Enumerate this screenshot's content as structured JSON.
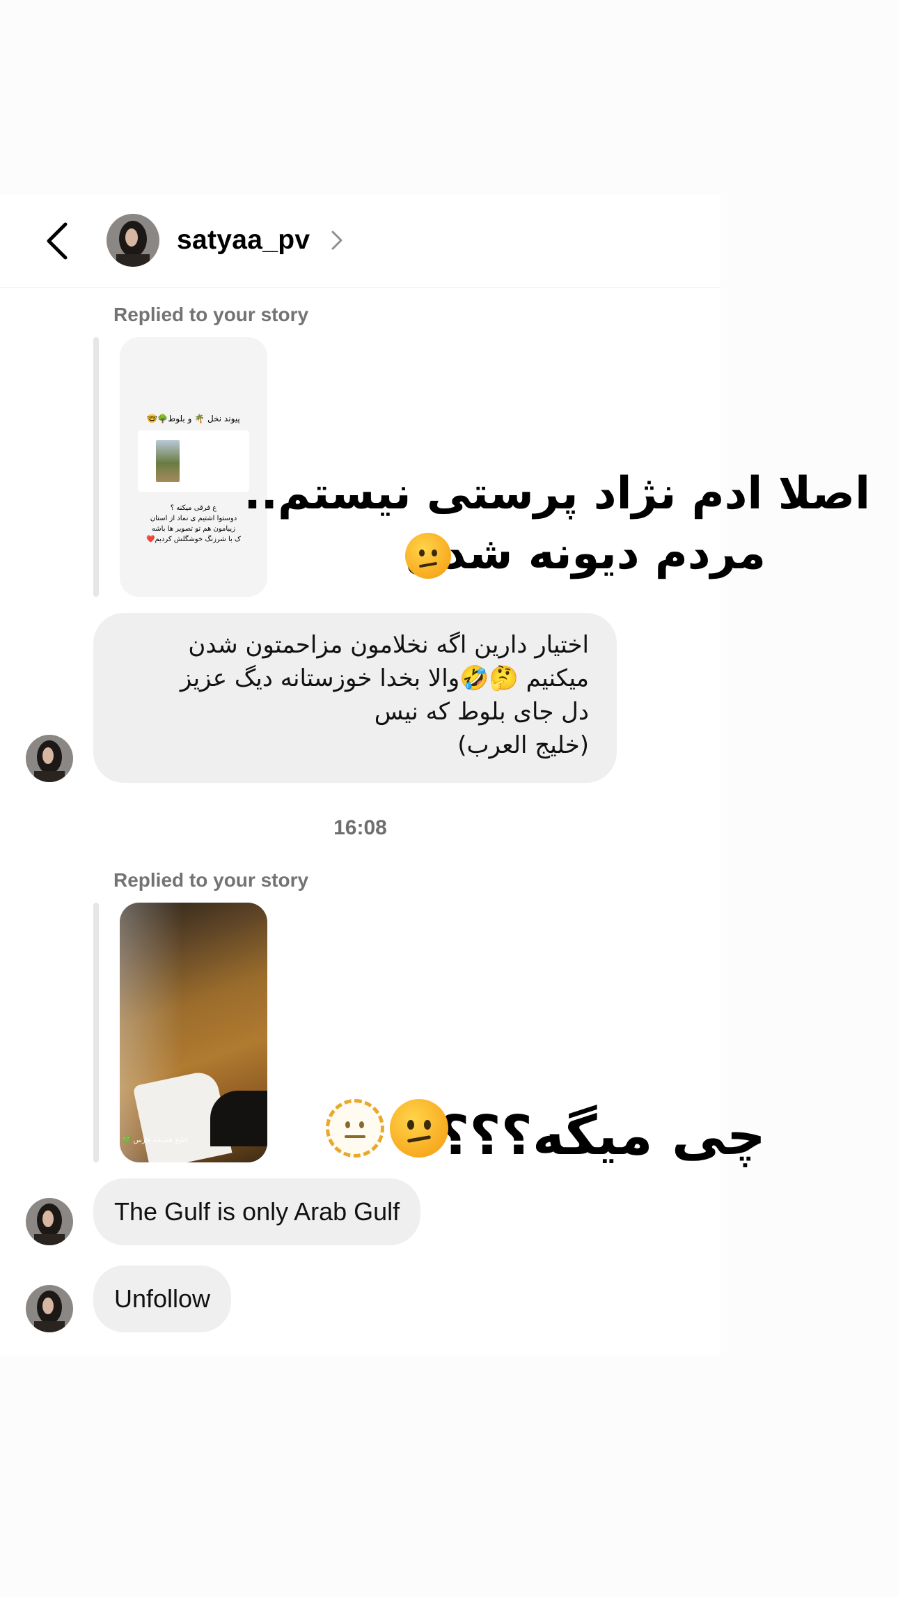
{
  "header": {
    "username": "satyaa_pv"
  },
  "messages": {
    "story_reply_1": {
      "replied_label": "Replied to your story",
      "thumb_lines": [
        "پیوند نخل 🌴 و بلوط🌳🤓",
        "ع فرقی میکنه ؟",
        "دوستوا اشتیم ی نماد از استان",
        "زیبامون هم تو تصویر ها باشه",
        "ک با شرزنگ خوشگلش کردیم❤️"
      ],
      "overlay_line1": "اصلا ادم نژاد پرستی نیستم..",
      "overlay_line2": "مردم دیونه شدن"
    },
    "bubble_1": {
      "lines": [
        "اختیار دارین اگه نخلامون مزاحمتون شدن",
        "میکنیم 🤔🤣والا  بخدا خوزستانه دیگ عزیز",
        "دل جای بلوط که نیس",
        "(خلیج العرب)"
      ]
    },
    "timestamp": "16:08",
    "story_reply_2": {
      "replied_label": "Replied to your story",
      "thumb_caption": "خلیج همیشه فارس 💚",
      "overlay_text": "چی میگه؟؟؟؟"
    },
    "bubble_2": "The Gulf is only Arab Gulf",
    "bubble_3": "Unfollow"
  },
  "icons": {
    "back": "chevron-left-icon",
    "profile_link": "chevron-right-icon",
    "emoji_confused": "confused-face-emoji",
    "emoji_dotted": "dotted-line-face-emoji"
  },
  "colors": {
    "bubble": "#efefef",
    "muted_text": "#737373",
    "emoji_yellow": "#f7a51a"
  }
}
